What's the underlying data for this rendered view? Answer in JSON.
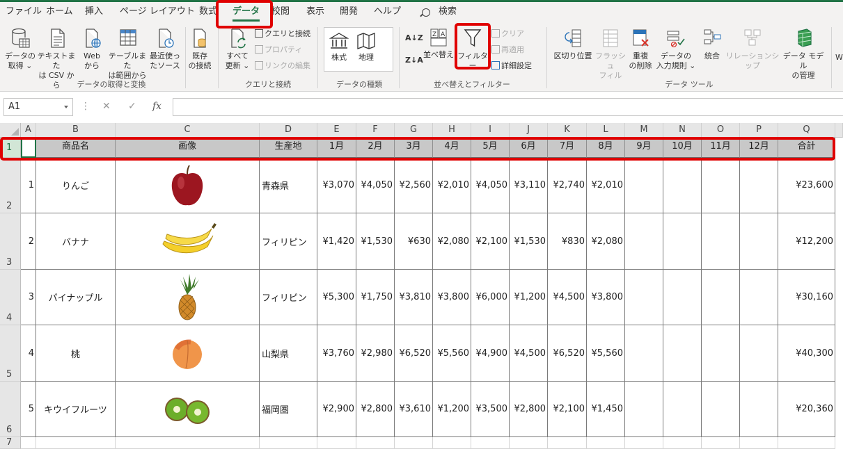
{
  "tabs": [
    "ファイル",
    "ホーム",
    "挿入",
    "ページ レイアウト",
    "数式",
    "データ",
    "校閲",
    "表示",
    "開発",
    "ヘルプ",
    "検索"
  ],
  "ribbon": {
    "get_data": "データの\n取得 ⌄",
    "text_csv": "テキストまた\nは CSV から",
    "web": "Web\nから",
    "table_range": "テーブルまた\nは範囲から",
    "recent": "最近使っ\nたソース",
    "existing": "既存\nの接続",
    "group_get": "データの取得と変換",
    "refresh_all": "すべて\n更新 ⌄",
    "queries": "クエリと接続",
    "properties": "プロパティ",
    "edit_links": "リンクの編集",
    "group_queries": "クエリと接続",
    "stocks": "株式",
    "geography": "地理",
    "group_types": "データの種類",
    "sort": "並べ替え",
    "filter": "フィルター",
    "clear": "クリア",
    "reapply": "再適用",
    "advanced": "詳細設定",
    "group_sort": "並べ替えとフィルター",
    "text_to_columns": "区切り位置",
    "flash_fill": "フラッシュ\nフィル",
    "remove_dup": "重複\nの削除",
    "validation": "データの\n入力規則 ⌄",
    "consolidate": "統合",
    "relationships": "リレーションシップ",
    "data_model": "データ モデル\nの管理",
    "group_tools": "データ ツール",
    "cut_off": "W"
  },
  "namebox": "A1",
  "fx": "fx",
  "columns": [
    "A",
    "B",
    "C",
    "D",
    "E",
    "F",
    "G",
    "H",
    "I",
    "J",
    "K",
    "L",
    "M",
    "N",
    "O",
    "P",
    "Q"
  ],
  "rows": [
    "1",
    "2",
    "3",
    "4",
    "5",
    "6",
    "7"
  ],
  "headers": [
    "商品名",
    "画像",
    "生産地",
    "1月",
    "2月",
    "3月",
    "4月",
    "5月",
    "6月",
    "7月",
    "8月",
    "9月",
    "10月",
    "11月",
    "12月",
    "合計"
  ],
  "data": [
    {
      "no": "1",
      "name": "りんご",
      "fruit": "apple",
      "origin": "青森県",
      "m": [
        "¥3,070",
        "¥4,050",
        "¥2,560",
        "¥2,010",
        "¥4,050",
        "¥3,110",
        "¥2,740",
        "¥2,010",
        "",
        "",
        "",
        ""
      ],
      "total": "¥23,600"
    },
    {
      "no": "2",
      "name": "バナナ",
      "fruit": "banana",
      "origin": "フィリピン",
      "m": [
        "¥1,420",
        "¥1,530",
        "¥630",
        "¥2,080",
        "¥2,100",
        "¥1,530",
        "¥830",
        "¥2,080",
        "",
        "",
        "",
        ""
      ],
      "total": "¥12,200"
    },
    {
      "no": "3",
      "name": "パイナップル",
      "fruit": "pineapple",
      "origin": "フィリピン",
      "m": [
        "¥5,300",
        "¥1,750",
        "¥3,810",
        "¥3,800",
        "¥6,000",
        "¥1,200",
        "¥4,500",
        "¥3,800",
        "",
        "",
        "",
        ""
      ],
      "total": "¥30,160"
    },
    {
      "no": "4",
      "name": "桃",
      "fruit": "peach",
      "origin": "山梨県",
      "m": [
        "¥3,760",
        "¥2,980",
        "¥6,520",
        "¥5,560",
        "¥4,900",
        "¥4,500",
        "¥6,520",
        "¥5,560",
        "",
        "",
        "",
        ""
      ],
      "total": "¥40,300"
    },
    {
      "no": "5",
      "name": "キウイフルーツ",
      "fruit": "kiwi",
      "origin": "福岡圏",
      "m": [
        "¥2,900",
        "¥2,800",
        "¥3,610",
        "¥1,200",
        "¥3,500",
        "¥2,800",
        "¥2,100",
        "¥1,450",
        "",
        "",
        "",
        ""
      ],
      "total": "¥20,360"
    }
  ],
  "colors": {
    "accent": "#217346",
    "highlight": "#e00000",
    "header_fill": "#c8c8c8"
  }
}
